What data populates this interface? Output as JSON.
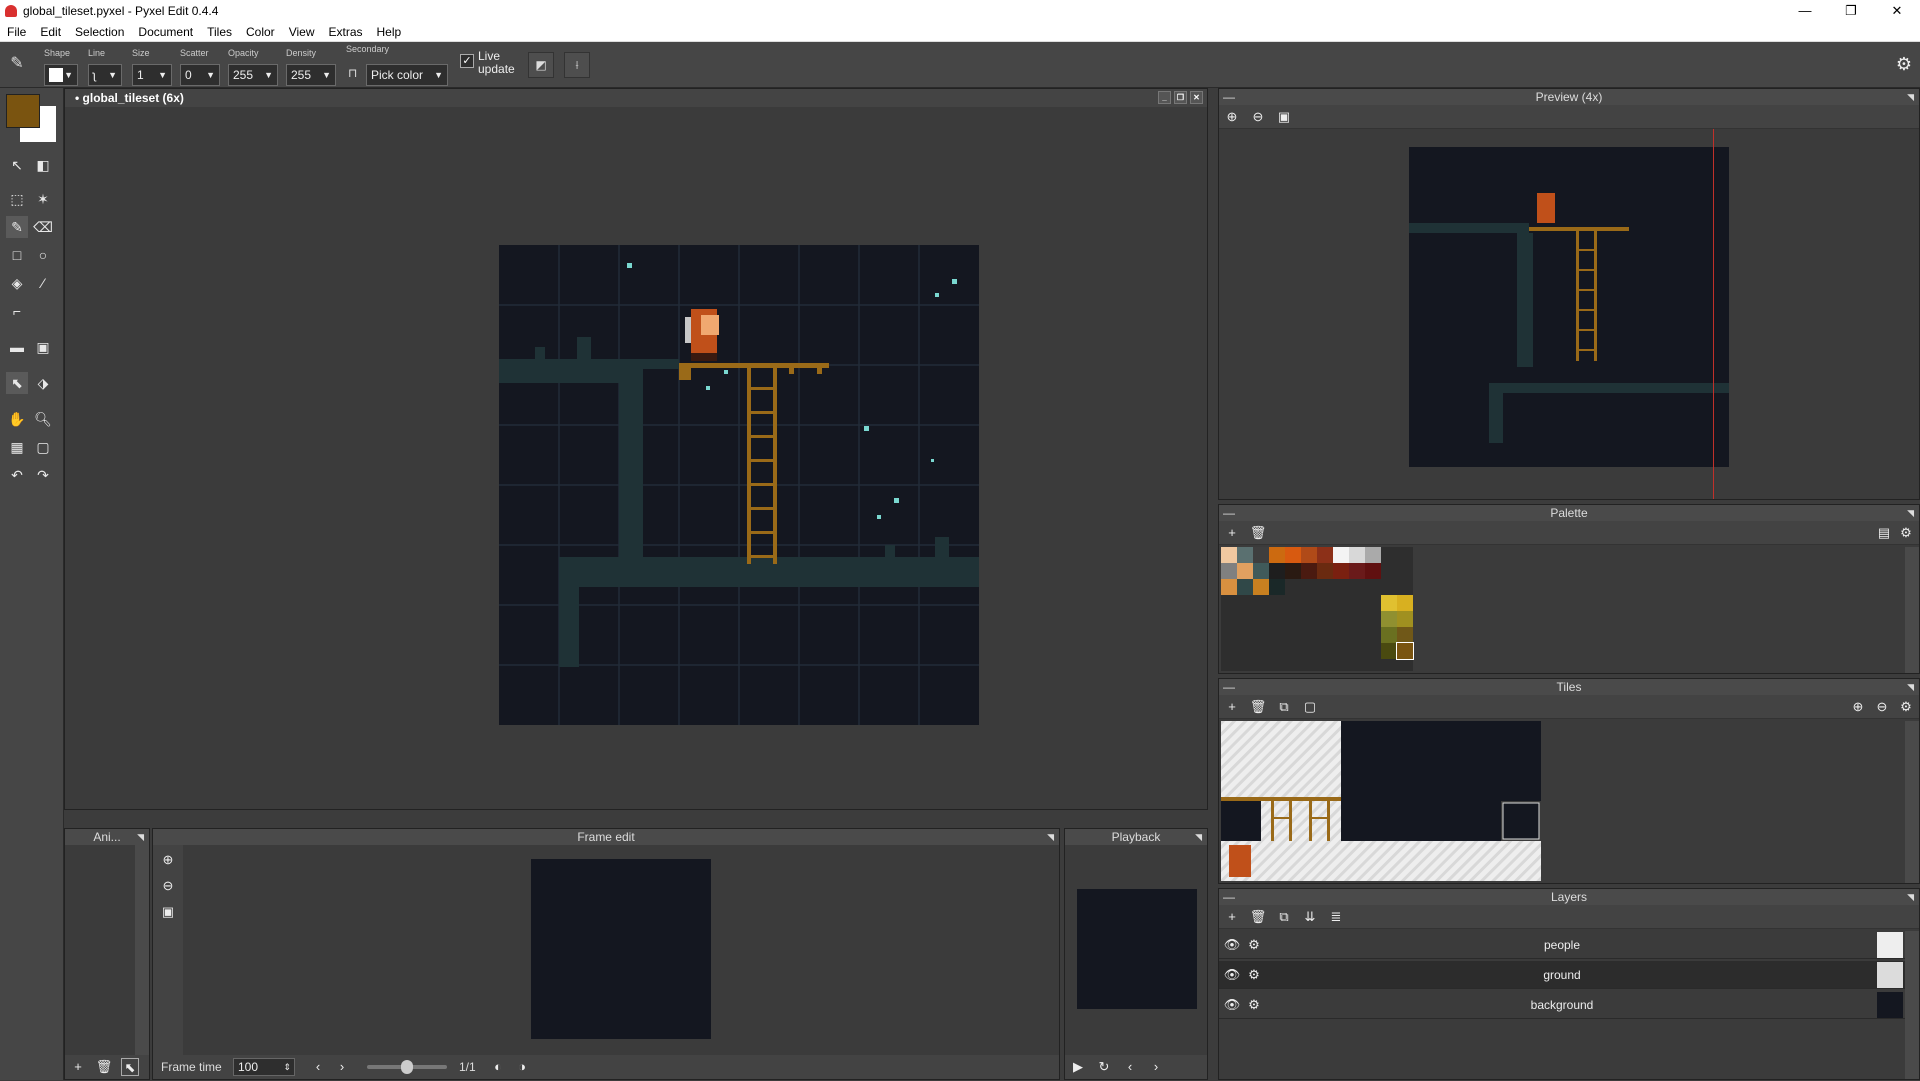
{
  "window": {
    "title": "global_tileset.pyxel - Pyxel Edit 0.4.4",
    "minimize": "—",
    "maximize": "❐",
    "close": "✕"
  },
  "menu": [
    "File",
    "Edit",
    "Selection",
    "Document",
    "Tiles",
    "Color",
    "View",
    "Extras",
    "Help"
  ],
  "toolbar": {
    "shape_label": "Shape",
    "line_label": "Line",
    "size_label": "Size",
    "size_value": "1",
    "scatter_label": "Scatter",
    "scatter_value": "0",
    "opacity_label": "Opacity",
    "opacity_value": "255",
    "density_label": "Density",
    "density_value": "255",
    "secondary_label": "Secondary",
    "secondary_value": "Pick color",
    "live_update_label": "Live update",
    "live_update_checked": true
  },
  "colors": {
    "primary": "#7a5410",
    "secondary": "#ffffff",
    "accent_red": "#d9302f"
  },
  "document": {
    "tab_title": "• global_tileset   (6x)",
    "zoom": "6x"
  },
  "panels": {
    "preview": {
      "title": "Preview (4x)"
    },
    "palette": {
      "title": "Palette"
    },
    "tiles": {
      "title": "Tiles"
    },
    "layers": {
      "title": "Layers",
      "items": [
        {
          "name": "people",
          "selected": false
        },
        {
          "name": "ground",
          "selected": true
        },
        {
          "name": "background",
          "selected": false
        }
      ]
    },
    "animations": {
      "title": "Ani..."
    },
    "frame_edit": {
      "title": "Frame edit",
      "frame_time_label": "Frame time",
      "frame_time_value": "100",
      "frame_counter": "1/1"
    },
    "playback": {
      "title": "Playback"
    }
  },
  "palette_colors": [
    "#f0c8a0",
    "#5a7070",
    "#3e3e3e",
    "#cc6a10",
    "#d85a10",
    "#b04a18",
    "#8c3018",
    "#f4f4f4",
    "#d8d8d8",
    "#aaaaaa",
    "#808080",
    "#e0a060",
    "#405a5a",
    "#1e1e1e",
    "#2a1a12",
    "#4a1a10",
    "#6a2a10",
    "#7a2010",
    "#6a1a1a",
    "#601010",
    "#d89040",
    "#304848",
    "#c88020",
    "#1a2828"
  ],
  "palette_yellows": [
    "#e0c030",
    "#d8b020",
    "#909030",
    "#a09020",
    "#6a7020",
    "#705818",
    "#4a4a10",
    "#7a5410"
  ]
}
